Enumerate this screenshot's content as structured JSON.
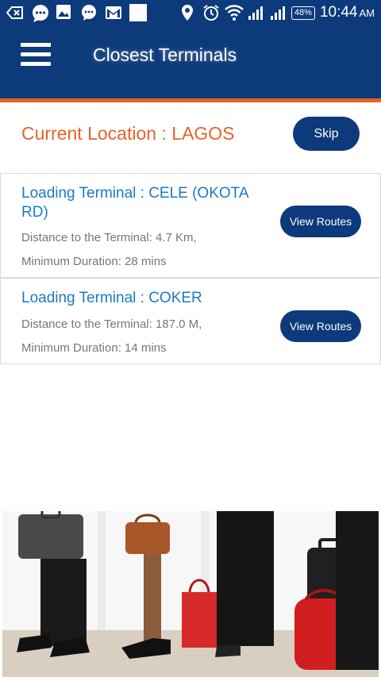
{
  "status_bar": {
    "battery": "48%",
    "time": "10:44",
    "ampm": "AM"
  },
  "app_bar": {
    "title": "Closest Terminals"
  },
  "location": {
    "label": "Current Location : LAGOS",
    "skip_label": "Skip"
  },
  "terminals": [
    {
      "name": "Loading Terminal : CELE (OKOTA RD)",
      "distance": "Distance to the Terminal: 4.7 Km,",
      "duration": "Minimum Duration: 28 mins",
      "button": "View Routes"
    },
    {
      "name": "Loading Terminal : COKER",
      "distance": "Distance to the Terminal: 187.0 M,",
      "duration": "Minimum Duration: 14 mins",
      "button": "View Routes"
    }
  ],
  "colors": {
    "primary": "#0d3a7a",
    "accent": "#e8632a",
    "link": "#1c7bc0"
  }
}
